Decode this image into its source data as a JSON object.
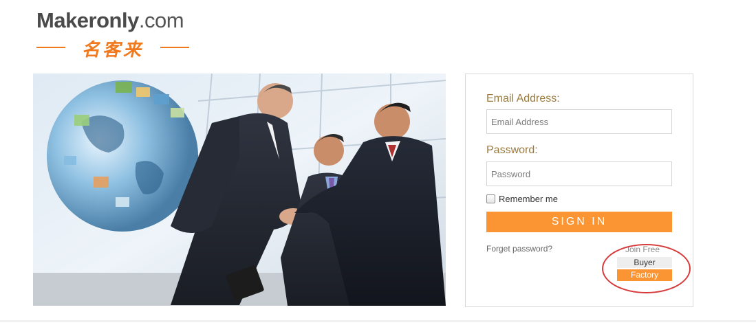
{
  "logo": {
    "brand": "Makeronly",
    "domain": ".com",
    "chinese": "名客来",
    "accent_color": "#f0791e"
  },
  "login": {
    "email_label": "Email Address:",
    "email_placeholder": "Email Address",
    "password_label": "Password:",
    "password_placeholder": "Password",
    "remember_label": "Remember me",
    "signin_label": "SIGN  IN",
    "forget_label": "Forget password?",
    "join_label": "Join Free",
    "buyer_label": "Buyer",
    "factory_label": "Factory",
    "button_color": "#fb9533",
    "label_color": "#9b7b3c"
  },
  "annotation": {
    "circle_color": "#d83a3a"
  }
}
